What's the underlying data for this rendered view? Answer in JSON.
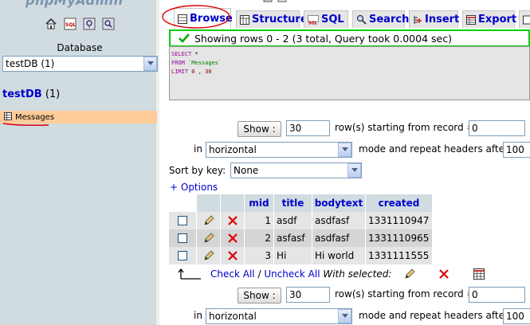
{
  "sidebar": {
    "logo": "phpMyAdmin",
    "icons": [
      "home-icon",
      "sql-icon",
      "query-window-icon",
      "help-icon"
    ],
    "database_label": "Database",
    "database_select": "testDB (1)",
    "db_name": "testDB",
    "db_count": "(1)",
    "tables": [
      {
        "name": "Messages"
      }
    ]
  },
  "tabs": [
    {
      "label": "Browse",
      "icon": "browse-icon",
      "active": true
    },
    {
      "label": "Structure",
      "icon": "structure-icon"
    },
    {
      "label": "SQL",
      "icon": "sql-tab-icon"
    },
    {
      "label": "Search",
      "icon": "search-icon"
    },
    {
      "label": "Insert",
      "icon": "insert-icon"
    },
    {
      "label": "Export",
      "icon": "export-icon"
    }
  ],
  "message": "Showing rows 0 - 2 (3 total, Query took 0.0004 sec)",
  "sql": {
    "select": "SELECT",
    "star": "*",
    "from": "FROM",
    "table": "`Messages`",
    "limit": "LIMIT",
    "offset": "0",
    "comma": ",",
    "count": "30"
  },
  "nav": {
    "show_label": "Show :",
    "rows_value": "30",
    "rows_text": "row(s) starting from record #",
    "start_value": "0",
    "in_text": "in",
    "mode_value": "horizontal",
    "mode_text": "mode and repeat headers after",
    "repeat_value": "100"
  },
  "sort": {
    "label": "Sort by key:",
    "value": "None"
  },
  "options_link": "+ Options",
  "columns": [
    "mid",
    "title",
    "bodytext",
    "created"
  ],
  "rows": [
    {
      "mid": "1",
      "title": "asdf",
      "bodytext": "asdfasf",
      "created": "1331110947"
    },
    {
      "mid": "2",
      "title": "asfasf",
      "bodytext": "asdfasf",
      "created": "1331110965"
    },
    {
      "mid": "3",
      "title": "Hi",
      "bodytext": "Hi world",
      "created": "1331111555"
    }
  ],
  "bulk": {
    "check_all": "Check All",
    "separator": "/",
    "uncheck_all": "Uncheck All",
    "with_selected": "With selected:"
  },
  "colors": {
    "link": "#0000cc",
    "sidebar_bg": "#d0dce0",
    "highlight_row": "#ffcc99",
    "success_border": "#00d000",
    "annotation": "#dd0000"
  }
}
